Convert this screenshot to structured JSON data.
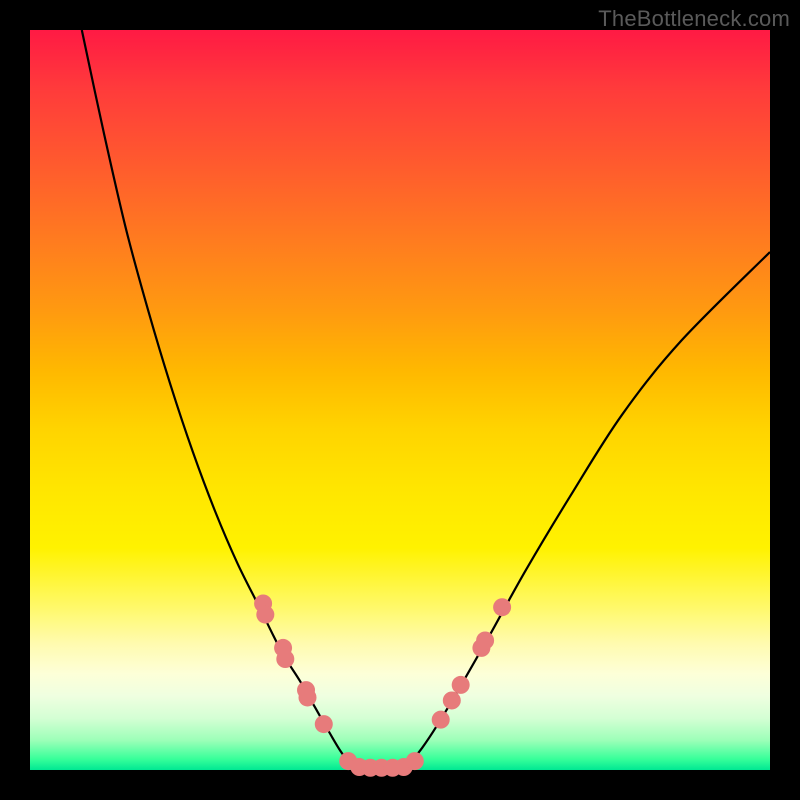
{
  "watermark": "TheBottleneck.com",
  "chart_data": {
    "type": "line",
    "title": "",
    "xlabel": "",
    "ylabel": "",
    "xlim": [
      0,
      100
    ],
    "ylim": [
      0,
      100
    ],
    "series": [
      {
        "name": "left-curve",
        "x": [
          7,
          10,
          13,
          16,
          19,
          22,
          25,
          28,
          31,
          34,
          36.5,
          38.5,
          40.5,
          42,
          43.5
        ],
        "y": [
          100,
          86,
          73,
          62,
          52,
          43,
          35,
          28,
          22,
          16,
          12,
          8.5,
          5,
          2.5,
          0.5
        ]
      },
      {
        "name": "right-curve",
        "x": [
          51,
          53,
          55,
          58,
          62,
          67,
          73,
          80,
          88,
          100
        ],
        "y": [
          0.5,
          3,
          6,
          11,
          18,
          27,
          37,
          48,
          58,
          70
        ]
      }
    ],
    "flat_bottom_range_x": [
      43.5,
      51
    ],
    "markers": {
      "name": "data-points",
      "color": "#e77b7b",
      "points": [
        {
          "x": 31.5,
          "y": 22.5
        },
        {
          "x": 31.8,
          "y": 21
        },
        {
          "x": 34.2,
          "y": 16.5
        },
        {
          "x": 34.5,
          "y": 15
        },
        {
          "x": 37.3,
          "y": 10.8
        },
        {
          "x": 37.5,
          "y": 9.8
        },
        {
          "x": 39.7,
          "y": 6.2
        },
        {
          "x": 43,
          "y": 1.2
        },
        {
          "x": 44.5,
          "y": 0.4
        },
        {
          "x": 46,
          "y": 0.3
        },
        {
          "x": 47.5,
          "y": 0.3
        },
        {
          "x": 49,
          "y": 0.3
        },
        {
          "x": 50.5,
          "y": 0.4
        },
        {
          "x": 52,
          "y": 1.2
        },
        {
          "x": 55.5,
          "y": 6.8
        },
        {
          "x": 57,
          "y": 9.4
        },
        {
          "x": 58.2,
          "y": 11.5
        },
        {
          "x": 61,
          "y": 16.5
        },
        {
          "x": 61.5,
          "y": 17.5
        },
        {
          "x": 63.8,
          "y": 22
        }
      ]
    },
    "background_gradient": [
      "#ff1a44",
      "#ff7a20",
      "#ffd400",
      "#fffbb0",
      "#00e893"
    ]
  }
}
